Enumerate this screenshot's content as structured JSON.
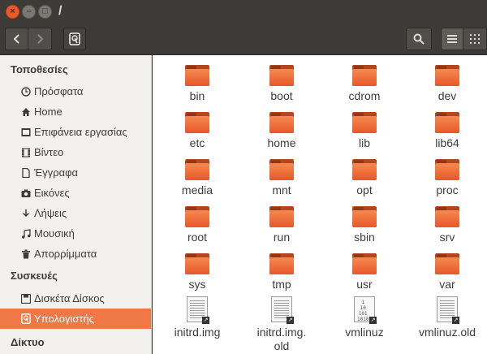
{
  "window": {
    "title": "/",
    "close_glyph": "×",
    "minimize_glyph": "–",
    "maximize_glyph": "□"
  },
  "toolbar": {
    "back_icon": "chevron-left-icon",
    "forward_icon": "chevron-right-icon",
    "location_icon": "drive-icon",
    "search_icon": "search-icon",
    "list_view_icon": "list-view-icon",
    "grid_view_icon": "grid-view-icon"
  },
  "sidebar": {
    "places_header": "Τοποθεσίες",
    "places": [
      {
        "label": "Πρόσφατα",
        "icon": "clock-icon"
      },
      {
        "label": "Home",
        "icon": "home-icon"
      },
      {
        "label": "Επιφάνεια εργασίας",
        "icon": "desktop-folder-icon"
      },
      {
        "label": "Βίντεο",
        "icon": "film-icon"
      },
      {
        "label": "Έγγραφα",
        "icon": "document-icon"
      },
      {
        "label": "Εικόνες",
        "icon": "camera-icon"
      },
      {
        "label": "Λήψεις",
        "icon": "download-icon"
      },
      {
        "label": "Μουσική",
        "icon": "music-icon"
      },
      {
        "label": "Απορρίμματα",
        "icon": "trash-icon"
      }
    ],
    "devices_header": "Συσκευές",
    "devices": [
      {
        "label": "Δισκέτα Δίσκος",
        "icon": "floppy-icon"
      },
      {
        "label": "Υπολογιστής",
        "icon": "computer-icon",
        "selected": true
      }
    ],
    "network_header": "Δίκτυο"
  },
  "files": [
    {
      "name": "bin",
      "type": "folder"
    },
    {
      "name": "boot",
      "type": "folder"
    },
    {
      "name": "cdrom",
      "type": "folder"
    },
    {
      "name": "dev",
      "type": "folder"
    },
    {
      "name": "etc",
      "type": "folder"
    },
    {
      "name": "home",
      "type": "folder"
    },
    {
      "name": "lib",
      "type": "folder"
    },
    {
      "name": "lib64",
      "type": "folder"
    },
    {
      "name": "media",
      "type": "folder"
    },
    {
      "name": "mnt",
      "type": "folder"
    },
    {
      "name": "opt",
      "type": "folder"
    },
    {
      "name": "proc",
      "type": "folder"
    },
    {
      "name": "root",
      "type": "folder"
    },
    {
      "name": "run",
      "type": "folder"
    },
    {
      "name": "sbin",
      "type": "folder"
    },
    {
      "name": "srv",
      "type": "folder"
    },
    {
      "name": "sys",
      "type": "folder"
    },
    {
      "name": "tmp",
      "type": "folder"
    },
    {
      "name": "usr",
      "type": "folder"
    },
    {
      "name": "var",
      "type": "folder"
    },
    {
      "name": "initrd.img",
      "type": "link"
    },
    {
      "name": "initrd.img.",
      "name2": "old",
      "type": "link"
    },
    {
      "name": "vmlinuz",
      "type": "binary-link",
      "bin_text": "1\n10\n101\n1010"
    },
    {
      "name": "vmlinuz.old",
      "type": "link"
    }
  ],
  "colors": {
    "accent": "#f07746",
    "folder": "#e8572a",
    "titlebar": "#3c3b37"
  }
}
